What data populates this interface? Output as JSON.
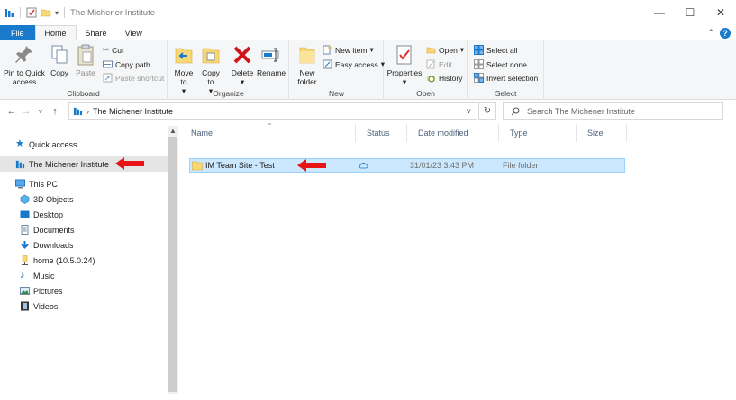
{
  "window": {
    "title": "The Michener Institute"
  },
  "tabs": {
    "file": "File",
    "home": "Home",
    "share": "Share",
    "view": "View"
  },
  "ribbon": {
    "clipboard": {
      "label": "Clipboard",
      "pin": "Pin to Quick access",
      "copy": "Copy",
      "paste": "Paste",
      "cut": "Cut",
      "copy_path": "Copy path",
      "paste_shortcut": "Paste shortcut"
    },
    "organize": {
      "label": "Organize",
      "move_to": "Move to",
      "copy_to": "Copy to",
      "delete": "Delete",
      "rename": "Rename"
    },
    "new": {
      "label": "New",
      "new_folder": "New folder",
      "new_item": "New item",
      "easy_access": "Easy access"
    },
    "open": {
      "label": "Open",
      "properties": "Properties",
      "open": "Open",
      "edit": "Edit",
      "history": "History"
    },
    "select": {
      "label": "Select",
      "select_all": "Select all",
      "select_none": "Select none",
      "invert": "Invert selection"
    }
  },
  "address": {
    "path": "The Michener Institute"
  },
  "search": {
    "placeholder": "Search The Michener Institute"
  },
  "nav": {
    "quick_access": "Quick access",
    "michener": "The Michener Institute",
    "this_pc": "This PC",
    "items": [
      "3D Objects",
      "Desktop",
      "Documents",
      "Downloads",
      "home (10.5.0.24)",
      "Music",
      "Pictures",
      "Videos"
    ]
  },
  "columns": {
    "name": "Name",
    "status": "Status",
    "date": "Date modified",
    "type": "Type",
    "size": "Size"
  },
  "files": [
    {
      "name": "IM Team Site - Test",
      "date": "31/01/23 3:43 PM",
      "type": "File folder"
    }
  ],
  "colors": {
    "accent": "#1979ca",
    "selection": "#cce8ff",
    "arrow": "#e81416",
    "folder": "#f8d775"
  }
}
